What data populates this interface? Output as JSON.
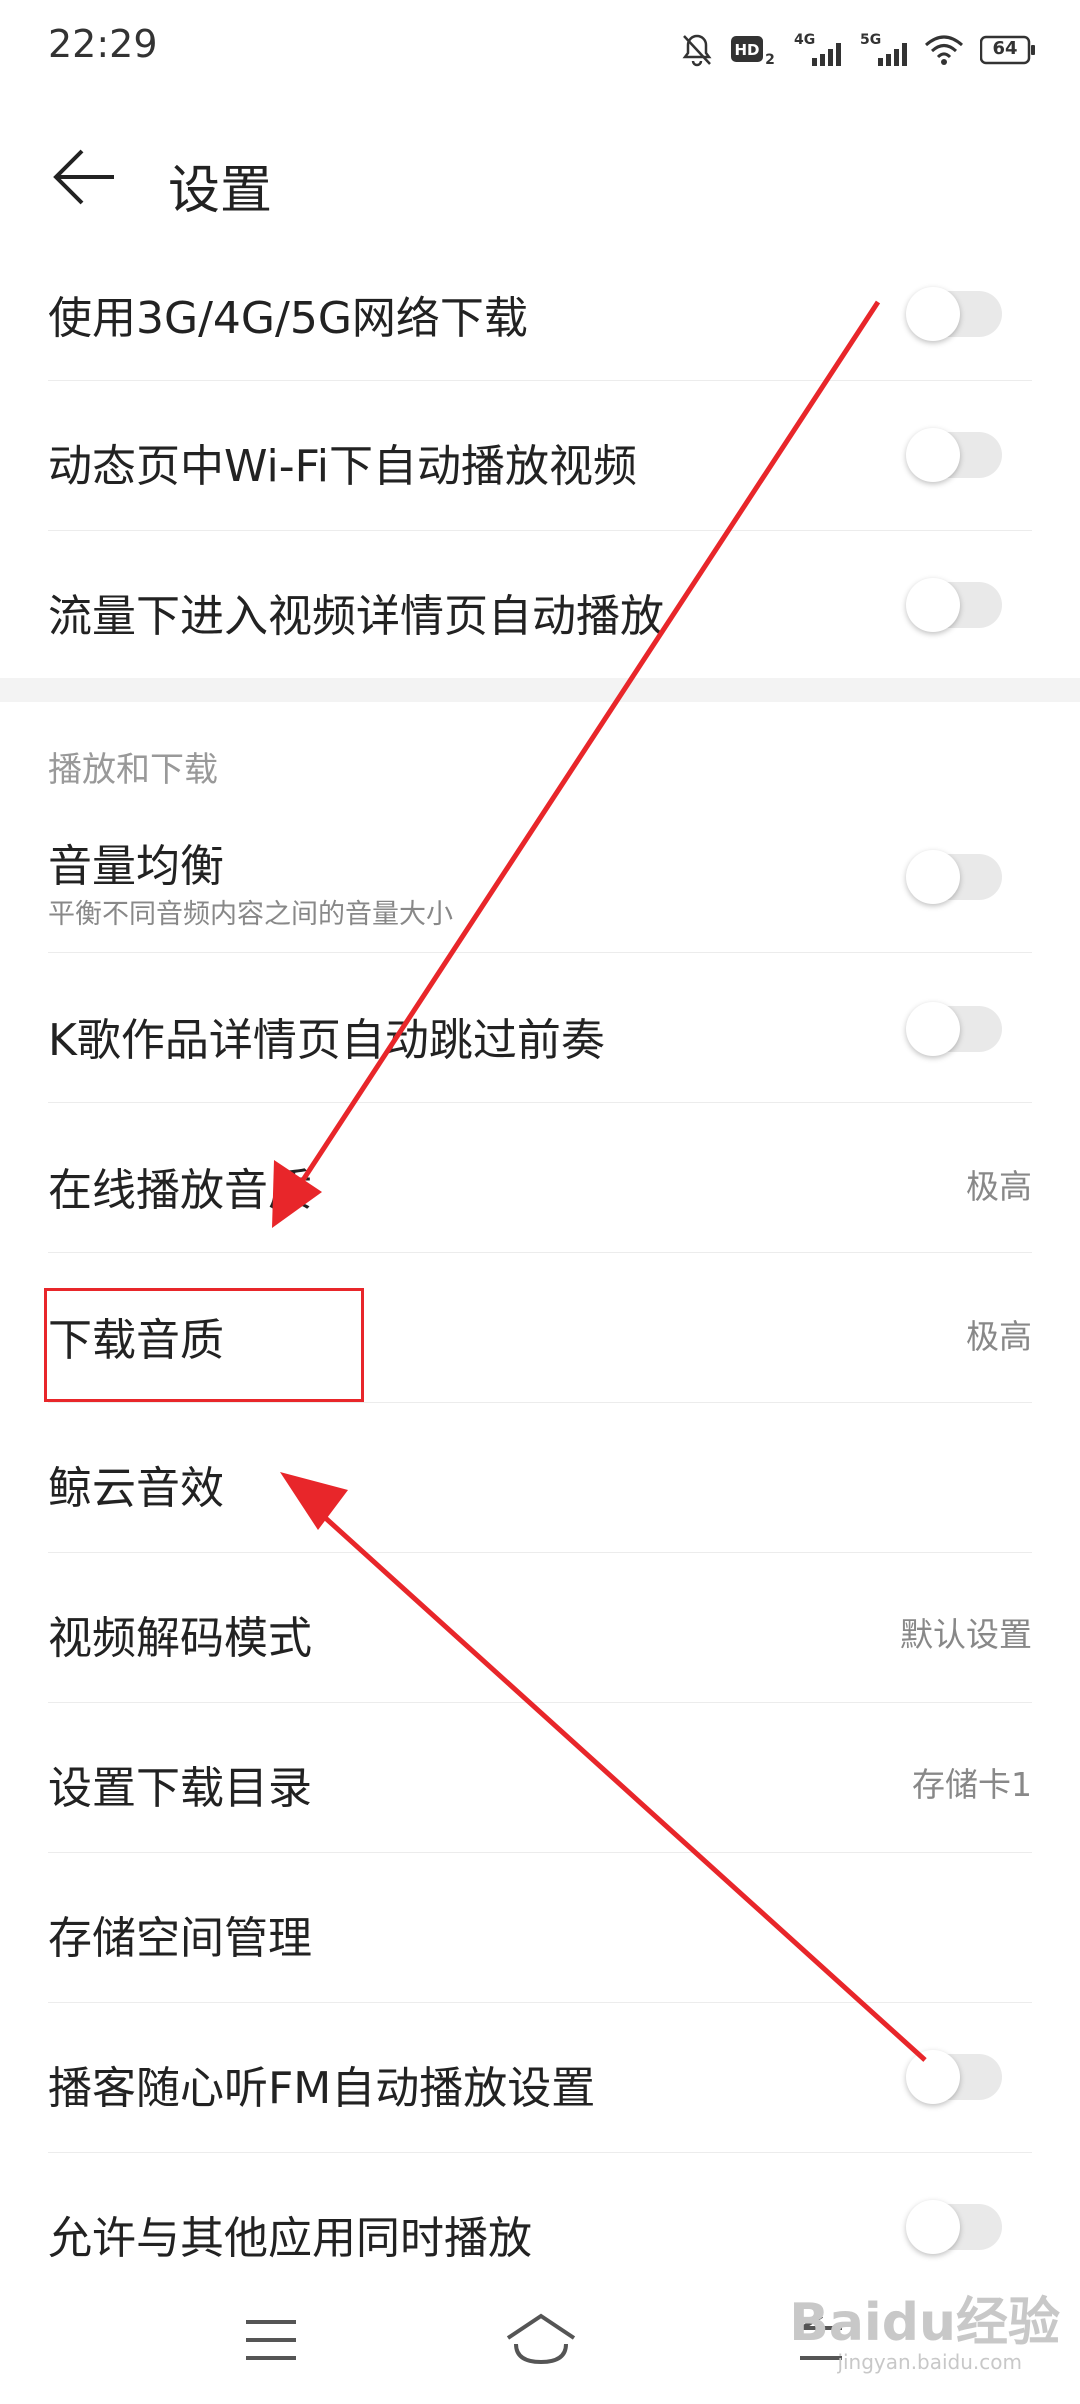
{
  "status_bar": {
    "time": "22:29",
    "icons": [
      "mute-icon",
      "hd-icon",
      "4g-signal-icon",
      "5g-signal-icon",
      "wifi-icon",
      "battery-icon"
    ],
    "battery_level": "64"
  },
  "header": {
    "back_icon": "back-arrow-icon",
    "title": "设置"
  },
  "network_group": [
    {
      "label": "使用3G/4G/5G网络下载",
      "type": "toggle",
      "on": false
    },
    {
      "label": "动态页中Wi-Fi下自动播放视频",
      "type": "toggle",
      "on": false
    },
    {
      "label": "流量下进入视频详情页自动播放",
      "type": "toggle",
      "on": false
    }
  ],
  "play_section": {
    "title": "播放和下载",
    "items": [
      {
        "label": "音量均衡",
        "sublabel": "平衡不同音频内容之间的音量大小",
        "type": "toggle",
        "on": false
      },
      {
        "label": "K歌作品详情页自动跳过前奏",
        "type": "toggle",
        "on": false
      },
      {
        "label": "在线播放音质",
        "type": "value",
        "value": "极高"
      },
      {
        "label": "下载音质",
        "type": "value",
        "value": "极高"
      },
      {
        "label": "鲸云音效",
        "type": "link"
      },
      {
        "label": "视频解码模式",
        "type": "value",
        "value": "默认设置"
      },
      {
        "label": "设置下载目录",
        "type": "value",
        "value": "存储卡1"
      },
      {
        "label": "存储空间管理",
        "type": "link"
      },
      {
        "label": "播客随心听FM自动播放设置",
        "type": "toggle",
        "on": false
      },
      {
        "label": "允许与其他应用同时播放",
        "type": "toggle",
        "on": false
      }
    ]
  },
  "nav_bar": {
    "icons": [
      "menu-icon",
      "home-icon",
      "back-nav-icon"
    ]
  },
  "annotation": {
    "color": "#e8262a",
    "highlighted_item": "下载音质"
  },
  "watermark": {
    "text": "Baidu经验",
    "sub": "jingyan.baidu.com"
  },
  "colors": {
    "background": "#ffffff",
    "text": "#222222",
    "secondary_text": "#888888",
    "toggle_off_track": "#e9e9e9",
    "divider": "#ececec"
  }
}
